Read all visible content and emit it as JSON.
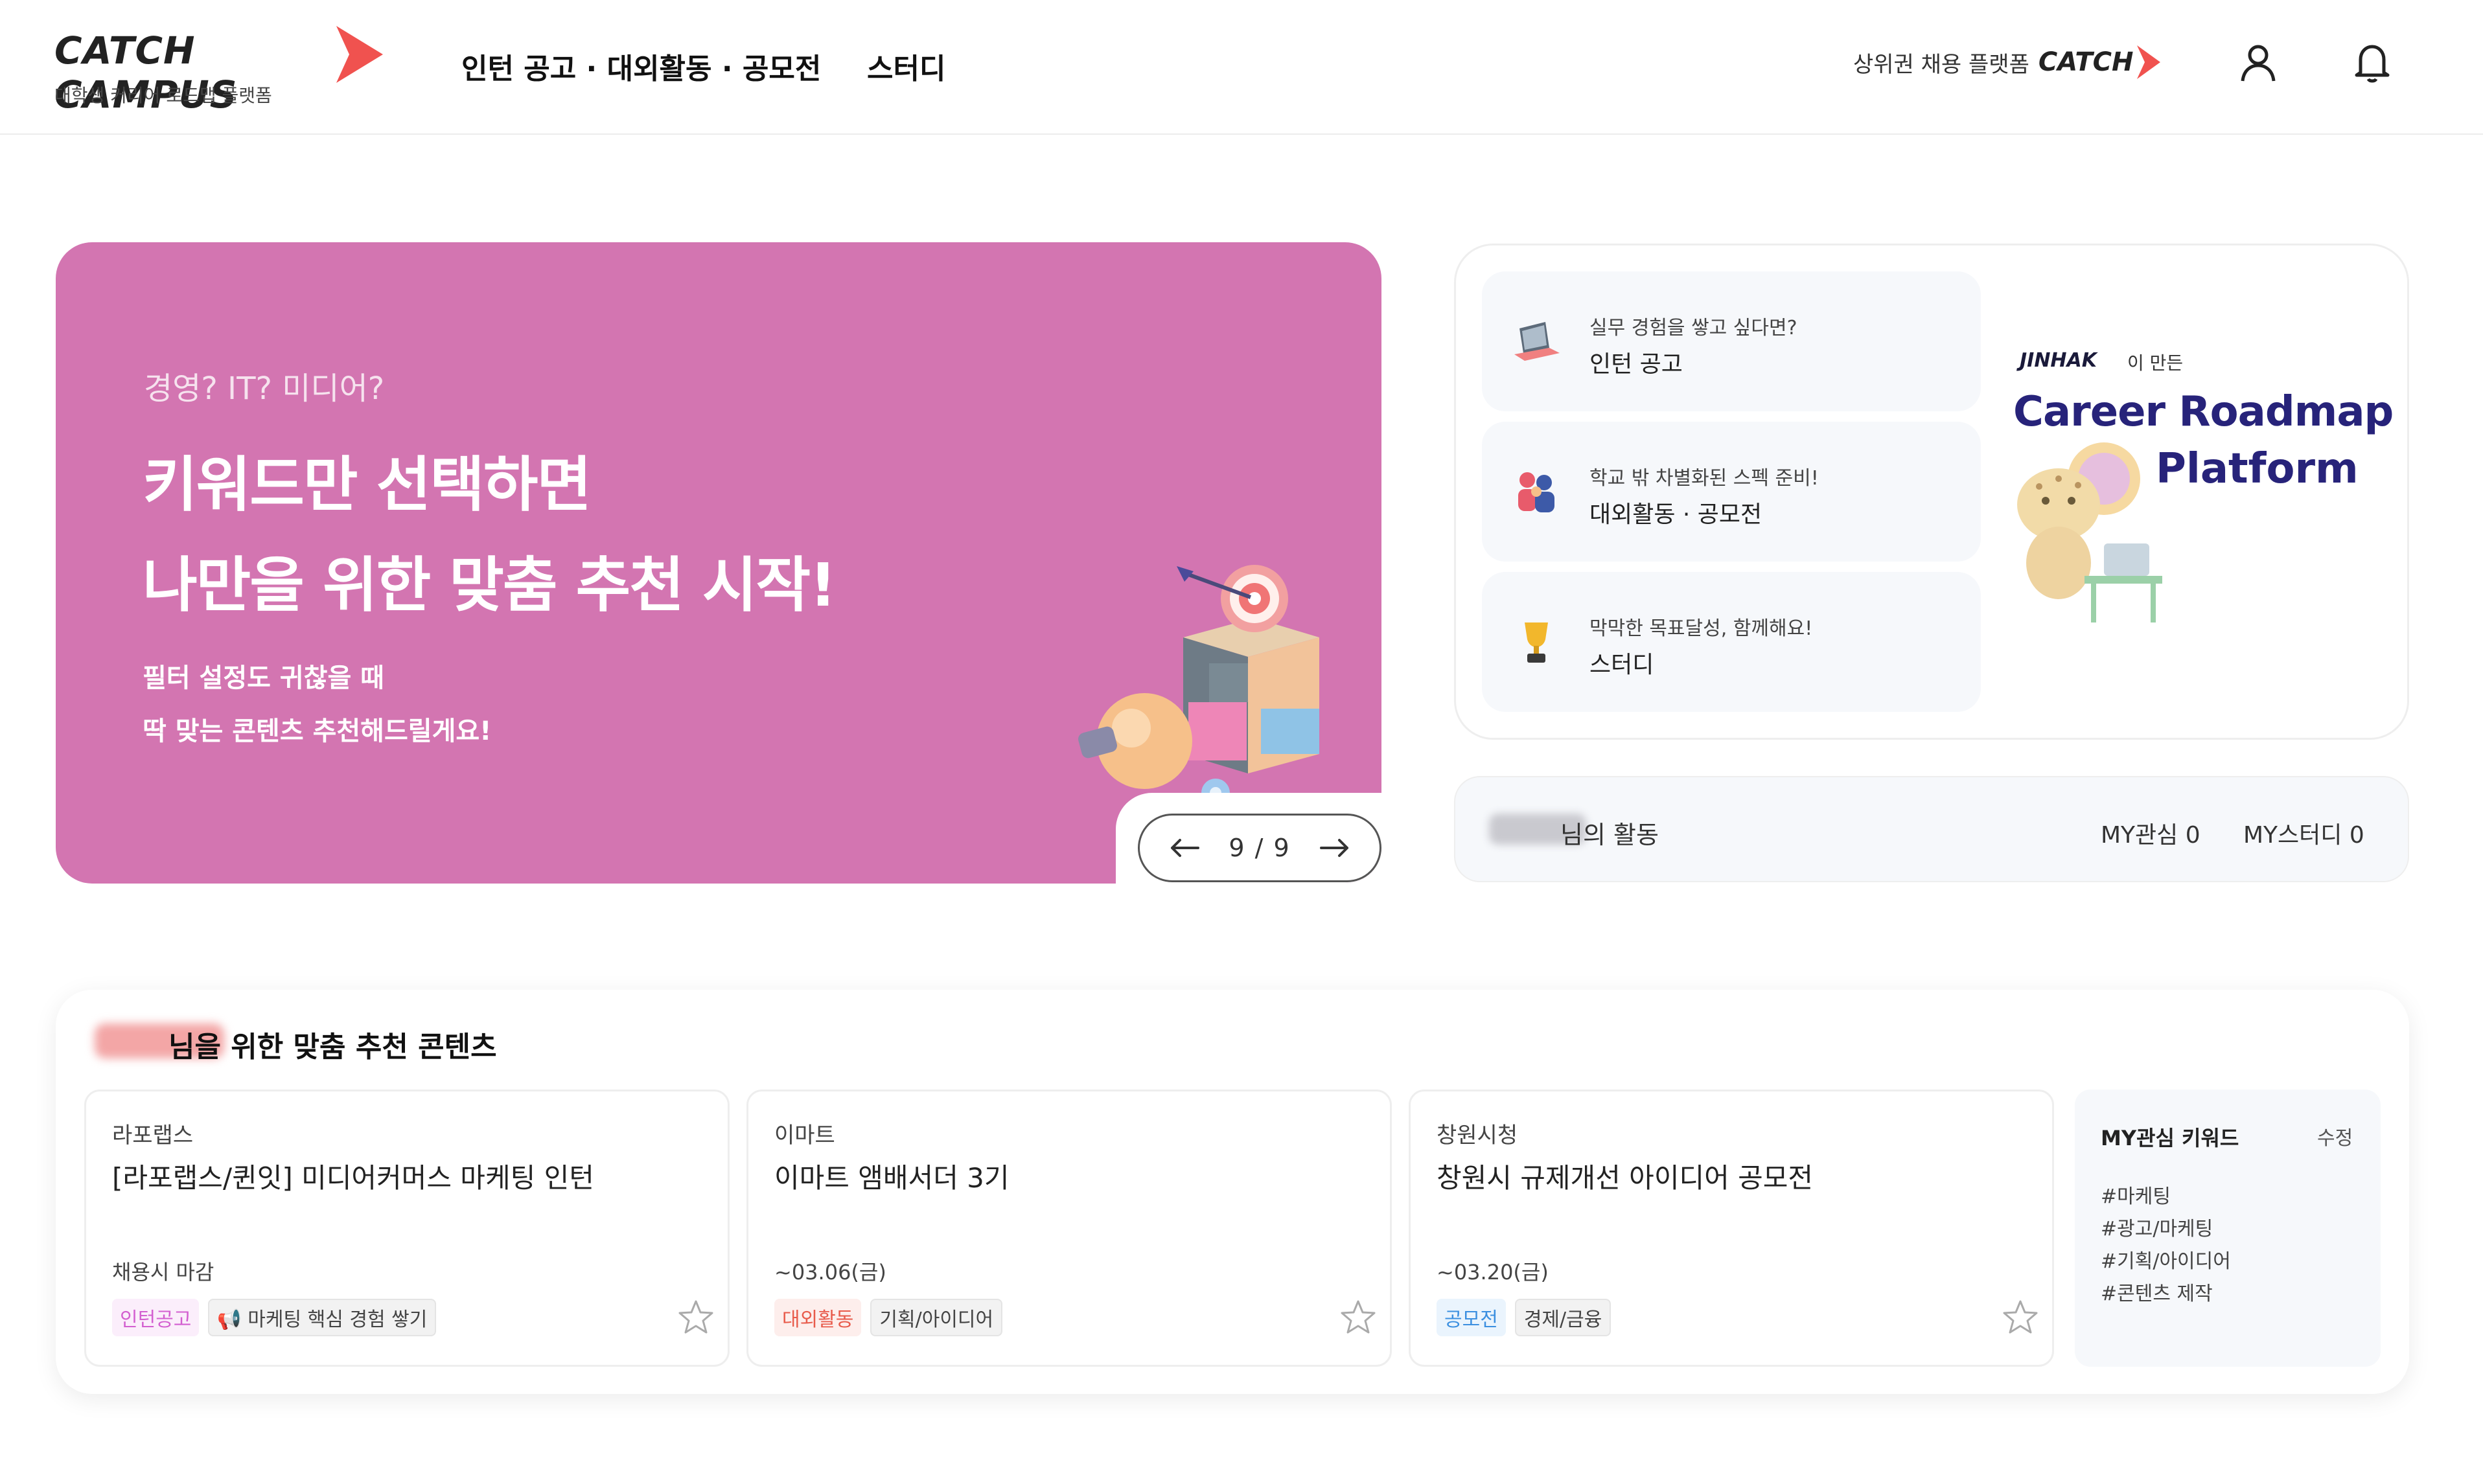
{
  "header": {
    "logo_text": "CATCH CAMPUS",
    "logo_sub": "대학생 커리어 로드맵 플랫폼",
    "nav": [
      "인턴 공고 · 대외활동 · 공모전",
      "스터디"
    ],
    "platform_label": "상위권 채용 플랫폼",
    "platform_brand": "CATCH",
    "brand_color": "#f0524f"
  },
  "banner": {
    "question": "경영? IT? 미디어?",
    "title_line1": "키워드만 선택하면",
    "title_line2": "나만을 위한 맞춤 추천 시작!",
    "sub_line1": "필터 설정도 귀찮을 때",
    "sub_line2": "딱 맞는 콘텐츠 추천해드릴게요!",
    "bg_color": "#d375b1",
    "pager": "9 / 9"
  },
  "quick_menu": {
    "items": [
      {
        "sub": "실무 경험을 쌓고 싶다면?",
        "title": "인턴 공고"
      },
      {
        "sub": "학교 밖 차별화된 스펙 준비!",
        "title": "대외활동 · 공모전"
      },
      {
        "sub": "막막한 목표달성, 함께해요!",
        "title": "스터디"
      }
    ],
    "career": {
      "jinhak": "JINHAK",
      "made_by": "이 만든",
      "title": "Career Roadmap",
      "platform": "Platform"
    }
  },
  "activity": {
    "label": "님의 활동",
    "my_fav": "MY관심 0",
    "my_study": "MY스터디 0"
  },
  "recommend": {
    "title": "님을 위한 맞춤 추천 콘텐츠",
    "cards": [
      {
        "company": "라포랩스",
        "title": "[라포랩스/퀸잇] 미디어커머스 마케팅 인턴",
        "date": "채용시 마감",
        "tags": [
          {
            "text": "인턴공고",
            "color": "#d35fd0",
            "bg": "#fbeefb"
          },
          {
            "text": "📢 마케팅 핵심 경험 쌓기",
            "color": "#333333",
            "bg": "#f2f2f2"
          }
        ]
      },
      {
        "company": "이마트",
        "title": "이마트 앰배서더 3기",
        "date": "~03.06(금)",
        "tags": [
          {
            "text": "대외활동",
            "color": "#e85b4b",
            "bg": "#fdeeec"
          },
          {
            "text": "기획/아이디어",
            "color": "#333333",
            "bg": "#f2f2f2"
          }
        ]
      },
      {
        "company": "창원시청",
        "title": "창원시 규제개선 아이디어 공모전",
        "date": "~03.20(금)",
        "tags": [
          {
            "text": "공모전",
            "color": "#3b8fe0",
            "bg": "#eaf4fd"
          },
          {
            "text": "경제/금융",
            "color": "#333333",
            "bg": "#f2f2f2"
          }
        ]
      }
    ],
    "keywords": {
      "title": "MY관심 키워드",
      "edit": "수정",
      "items": [
        "#마케팅",
        "#광고/마케팅",
        "#기획/아이디어",
        "#콘텐츠 제작"
      ]
    }
  }
}
